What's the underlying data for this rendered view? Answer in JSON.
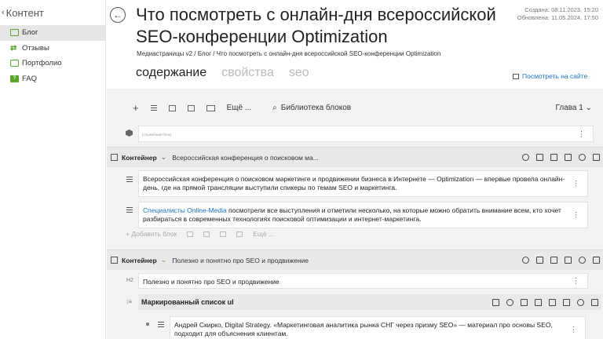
{
  "sidebar": {
    "title": "Контент",
    "items": [
      {
        "label": "Блог",
        "icon": "blog-icon",
        "active": true
      },
      {
        "label": "Отзывы",
        "icon": "reviews-icon",
        "active": false
      },
      {
        "label": "Портфолио",
        "icon": "portfolio-icon",
        "active": false
      },
      {
        "label": "FAQ",
        "icon": "faq-icon",
        "active": false
      }
    ]
  },
  "header": {
    "title": "Что посмотреть с онлайн-дня всероссийской SEO-конференции Optimization",
    "created": "Создана: 08.11.2023, 15:20",
    "updated": "Обновлена: 11.05.2024, 17:50",
    "breadcrumb": "Медиастраницы v2 / Блог / Что посмотреть с онлайн-дня всероссийской SEO-конференции Optimization",
    "tabs": [
      "содержание",
      "свойства",
      "seo"
    ],
    "view_on_site": "Посмотреть на сайте"
  },
  "toolbar": {
    "add": "+",
    "more": "Ещё ...",
    "library": "Библиотека блоков",
    "chapter": "Глава 1"
  },
  "service_block": "(служебный блок)",
  "containers": [
    {
      "label": "Контейнер",
      "title": "Всероссийская конференция о поисковом ма...",
      "blocks": [
        {
          "text": "Всероссийская конференция о поисковом маркетинге и продвижении бизнеса в Интернете — Optimization — впервые провела онлайн-день, где на прямой трансляции выступили спикеры по темам SEO и маркетинга."
        },
        {
          "link": "Специалисты Online-Media",
          "text": " посмотрели все выступления и отметили несколько, на которые можно обратить внимание всем, кто хочет разбираться в современных технологиях поисковой оптимизации и интернет-маркетинга."
        }
      ],
      "add_block": "+ Добавить блок",
      "add_more": "Ещё ..."
    },
    {
      "label": "Контейнер",
      "title": "Полезно и понятно про SEO и продвижение",
      "h2_icon": "H2",
      "h2_text": "Полезно и понятно про SEO и продвижение",
      "list_title": "Маркированный список ul",
      "list_item": "Андрей Скирко, Digital Strategy. «Маркетинговая аналитика рынка СНГ через призму SEO» — материал про основы SEO, подходит для объяснения клиентам."
    }
  ],
  "colors": {
    "accent_green": "#5aa626",
    "link_blue": "#1a73c8"
  }
}
